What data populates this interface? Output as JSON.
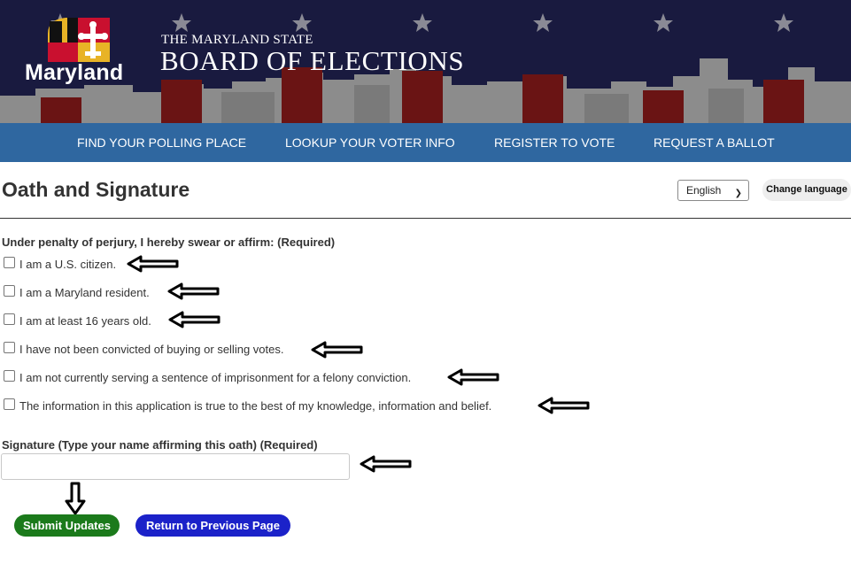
{
  "header": {
    "logo_text": "Maryland",
    "title_small": "THE MARYLAND STATE",
    "title_big": "BOARD OF ELECTIONS"
  },
  "nav": {
    "items": [
      {
        "label": "FIND YOUR POLLING PLACE"
      },
      {
        "label": "LOOKUP YOUR VOTER INFO"
      },
      {
        "label": "REGISTER TO VOTE"
      },
      {
        "label": "REQUEST A BALLOT"
      }
    ]
  },
  "page": {
    "title": "Oath and Signature",
    "language_selected": "English",
    "change_language_label": "Change language"
  },
  "oath": {
    "heading": "Under penalty of perjury, I hereby swear or affirm: (Required)",
    "items": [
      {
        "label": "I am a U.S. citizen.",
        "checked": false
      },
      {
        "label": "I am a Maryland resident.",
        "checked": false
      },
      {
        "label": "I am at least 16 years old.",
        "checked": false
      },
      {
        "label": "I have not been convicted of buying or selling votes.",
        "checked": false
      },
      {
        "label": "I am not currently serving a sentence of imprisonment for a felony conviction.",
        "checked": false
      },
      {
        "label": "The information in this application is true to the best of my knowledge, information and belief.",
        "checked": false
      }
    ]
  },
  "signature": {
    "label": "Signature (Type your name affirming this oath) (Required)",
    "value": ""
  },
  "buttons": {
    "submit_label": "Submit Updates",
    "return_label": "Return to Previous Page"
  },
  "colors": {
    "banner_bg": "#191a3f",
    "nav_bg": "#2f67a0",
    "submit_bg": "#1b7a1b",
    "return_bg": "#1b22c9"
  }
}
